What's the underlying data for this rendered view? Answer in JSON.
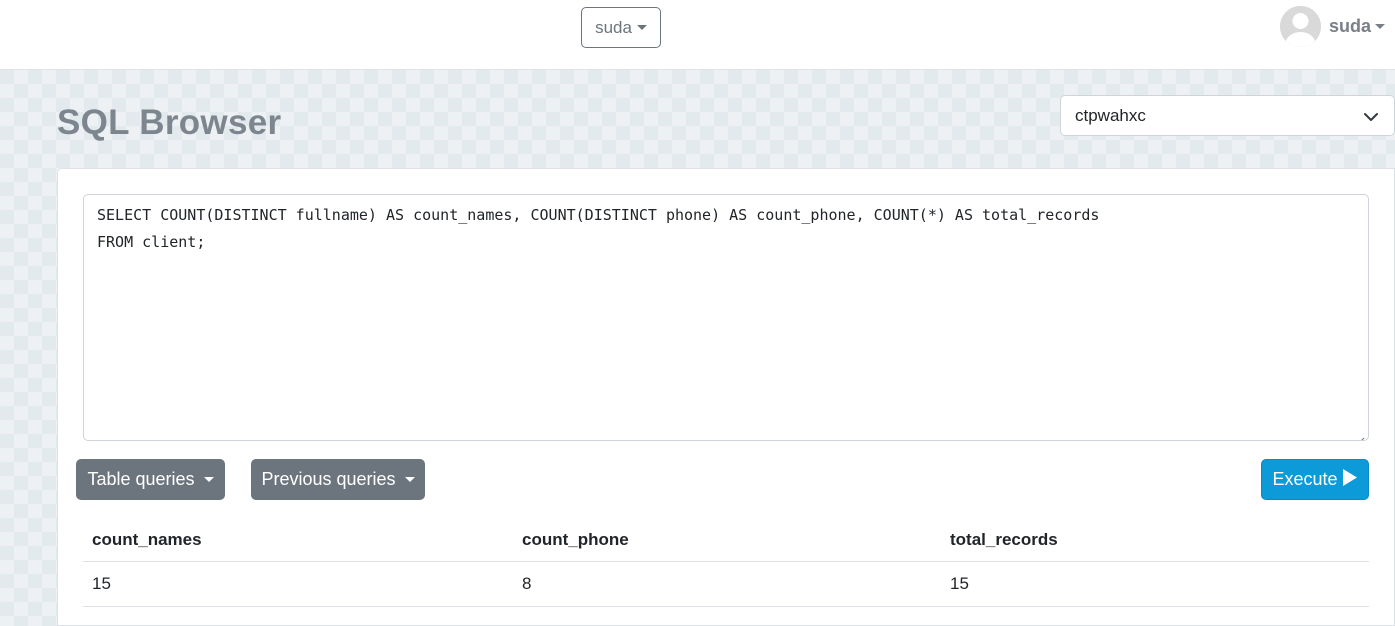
{
  "topbar": {
    "database_selector": {
      "label": "suda",
      "icon": "caret-down-icon"
    },
    "user_menu": {
      "name": "suda",
      "avatar_icon": "user-avatar-icon"
    }
  },
  "page": {
    "title": "SQL Browser",
    "connection_select": {
      "value": "ctpwahxc",
      "icon": "chevron-down-icon"
    }
  },
  "editor": {
    "query_lines": [
      "SELECT COUNT(DISTINCT fullname) AS count_names, COUNT(DISTINCT phone) AS count_phone, COUNT(*) AS total_records",
      "FROM client;"
    ],
    "query": "SELECT COUNT(DISTINCT fullname) AS count_names, COUNT(DISTINCT phone) AS count_phone, COUNT(*) AS total_records\nFROM client;"
  },
  "toolbar": {
    "table_queries_label": "Table queries",
    "previous_queries_label": "Previous queries",
    "execute_label": "Execute",
    "execute_icon": "play-icon",
    "execute_color": "#0d9ad9",
    "secondary_color": "#6c757d"
  },
  "results": {
    "columns": [
      "count_names",
      "count_phone",
      "total_records"
    ],
    "rows": [
      [
        "15",
        "8",
        "15"
      ]
    ]
  }
}
